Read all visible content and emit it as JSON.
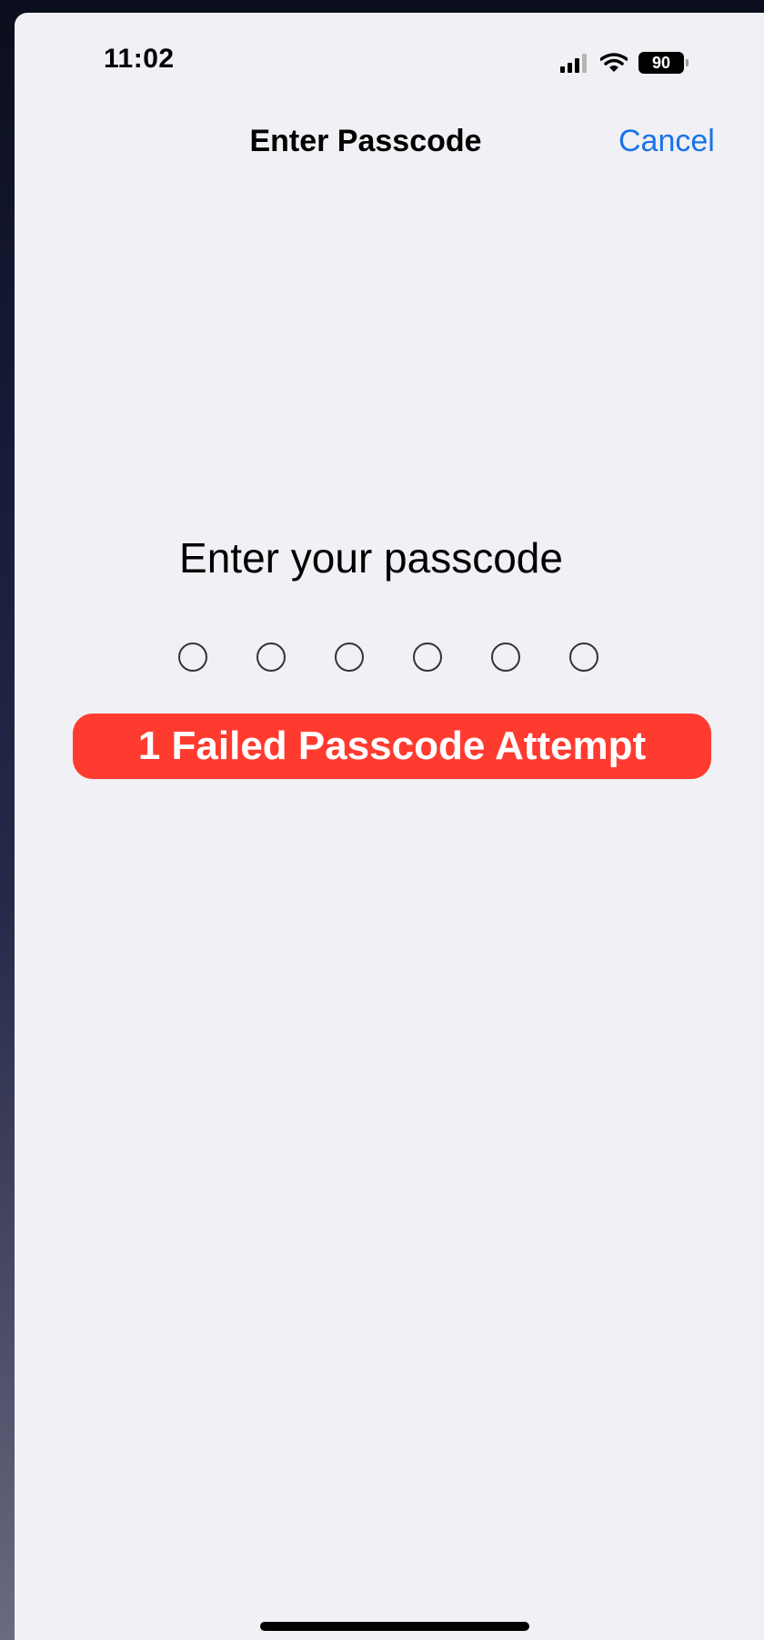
{
  "status_bar": {
    "time": "11:02",
    "battery_level": "90",
    "icons": [
      "signal-icon",
      "wifi-icon",
      "battery-icon"
    ]
  },
  "nav": {
    "title": "Enter Passcode",
    "cancel_label": "Cancel"
  },
  "passcode": {
    "prompt": "Enter your passcode",
    "digits_total": 6,
    "digits_entered": 0
  },
  "error": {
    "message": "1 Failed Passcode Attempt",
    "color": "#ff3b30"
  },
  "colors": {
    "accent": "#1a73e8",
    "background": "#f0f0f5"
  }
}
